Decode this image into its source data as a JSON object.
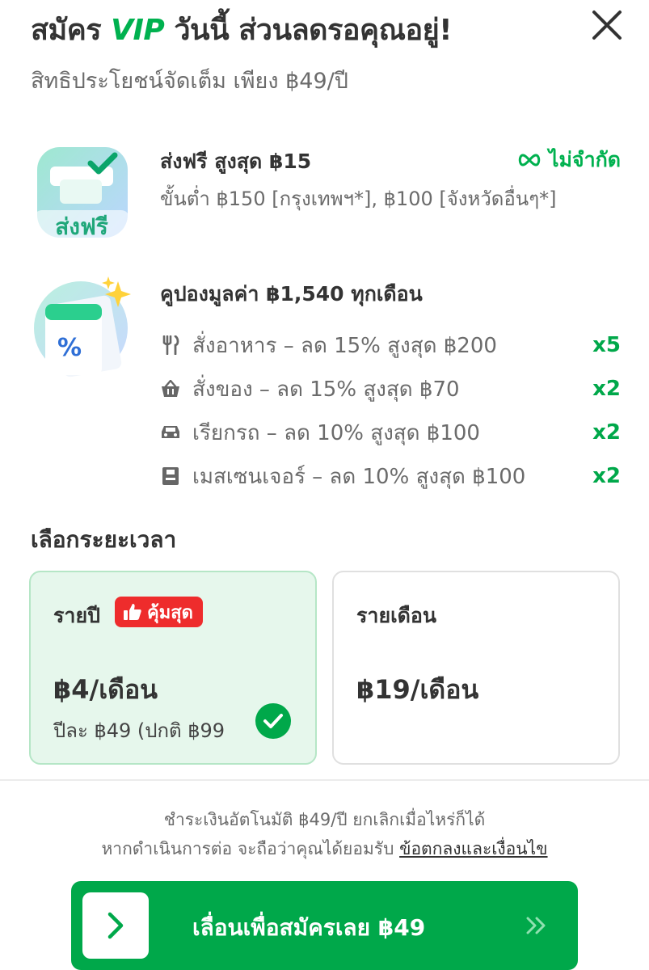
{
  "header": {
    "title_before": "สมัคร ",
    "title_vip": "VIP",
    "title_after": " วันนี้ ส่วนลดรอคุณอยู่!",
    "subtitle": "สิทธิประโยชน์จัดเต็ม เพียง ฿49/ปี"
  },
  "benefits": {
    "free_delivery": {
      "icon_text": "ส่งฟรี",
      "title": "ส่งฟรี สูงสุด ฿15",
      "description": "ขั้นต่ำ ฿150 [กรุงเทพฯ*], ฿100 [จังหวัดอื่นๆ*]",
      "limit_label": "ไม่จำกัด"
    },
    "coupons": {
      "title": "คูปองมูลค่า ฿1,540 ทุกเดือน",
      "items": [
        {
          "icon": "fork-knife-icon",
          "text": "สั่งอาหาร – ลด 15% สูงสุด ฿200",
          "qty": "x5"
        },
        {
          "icon": "basket-icon",
          "text": "สั่งของ – ลด 15% สูงสุด ฿70",
          "qty": "x2"
        },
        {
          "icon": "car-icon",
          "text": "เรียกรถ – ลด 10% สูงสุด ฿100",
          "qty": "x2"
        },
        {
          "icon": "parcel-icon",
          "text": "เมสเซนเจอร์ – ลด 10% สูงสุด ฿100",
          "qty": "x2"
        }
      ]
    }
  },
  "plans": {
    "section_label": "เลือกระยะเวลา",
    "yearly": {
      "name": "รายปี",
      "badge": "คุ้มสุด",
      "price": "฿4/เดือน",
      "note": "ปีละ ฿49 (ปกติ ฿99",
      "selected": true
    },
    "monthly": {
      "name": "รายเดือน",
      "price": "฿19/เดือน"
    }
  },
  "legal": {
    "line1": "ชำระเงินอัตโนมัติ ฿49/ปี ยกเลิกเมื่อไหร่ก็ได้",
    "line2_prefix": "หากดำเนินการต่อ จะถือว่าคุณได้ยอมรับ ",
    "terms_link": "ข้อตกลงและเงื่อนไข"
  },
  "cta": {
    "label": "เลื่อนเพื่อสมัครเลย ฿49"
  },
  "colors": {
    "brand_green": "#00b14f",
    "badge_red": "#ee2c2c",
    "selected_bg": "#e6f7ec"
  }
}
